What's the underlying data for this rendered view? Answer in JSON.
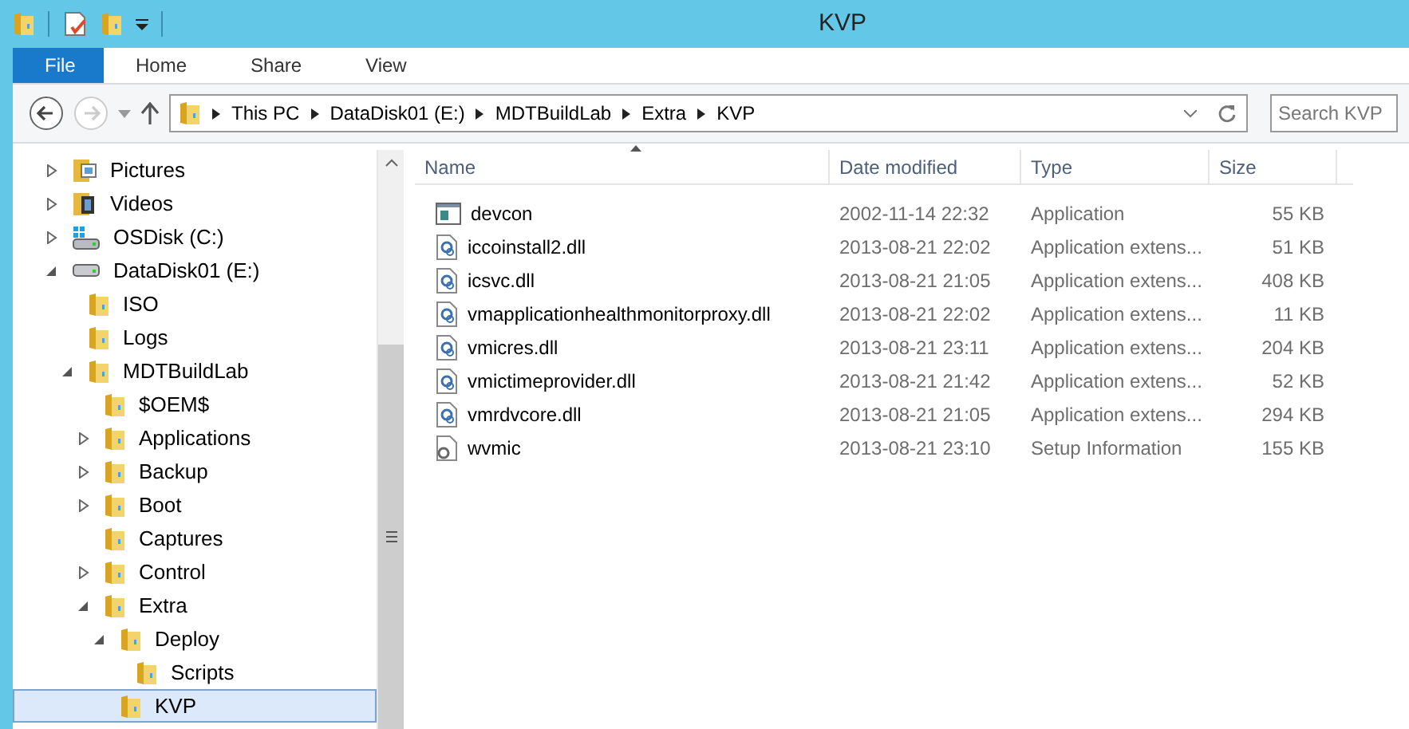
{
  "window": {
    "title": "KVP"
  },
  "ribbon_tabs": [
    {
      "label": "File",
      "selected": true
    },
    {
      "label": "Home",
      "selected": false
    },
    {
      "label": "Share",
      "selected": false
    },
    {
      "label": "View",
      "selected": false
    }
  ],
  "navigation": {
    "back_disabled": false,
    "forward_disabled": true
  },
  "address_bar": {
    "breadcrumbs": [
      "This PC",
      "DataDisk01 (E:)",
      "MDTBuildLab",
      "Extra",
      "KVP"
    ]
  },
  "search": {
    "placeholder": "Search KVP"
  },
  "tree": [
    {
      "label": "Pictures",
      "kind": "pictures",
      "expanded": false,
      "selected": false
    },
    {
      "label": "Videos",
      "kind": "videos",
      "expanded": false,
      "selected": false
    },
    {
      "label": "OSDisk (C:)",
      "kind": "os-drive",
      "expanded": false,
      "selected": false
    },
    {
      "label": "DataDisk01 (E:)",
      "kind": "drive",
      "expanded": true,
      "selected": false,
      "children": [
        {
          "label": "ISO",
          "kind": "folder",
          "selected": false
        },
        {
          "label": "Logs",
          "kind": "folder",
          "selected": false
        },
        {
          "label": "MDTBuildLab",
          "kind": "folder",
          "expanded": true,
          "selected": false,
          "children": [
            {
              "label": "$OEM$",
              "kind": "folder",
              "selected": false
            },
            {
              "label": "Applications",
              "kind": "folder",
              "expanded": false,
              "selected": false
            },
            {
              "label": "Backup",
              "kind": "folder",
              "expanded": false,
              "selected": false
            },
            {
              "label": "Boot",
              "kind": "folder",
              "expanded": false,
              "selected": false
            },
            {
              "label": "Captures",
              "kind": "folder",
              "selected": false
            },
            {
              "label": "Control",
              "kind": "folder",
              "expanded": false,
              "selected": false
            },
            {
              "label": "Extra",
              "kind": "folder",
              "expanded": true,
              "selected": false,
              "children": [
                {
                  "label": "Deploy",
                  "kind": "folder",
                  "expanded": true,
                  "selected": false,
                  "children": [
                    {
                      "label": "Scripts",
                      "kind": "folder",
                      "selected": false
                    }
                  ]
                },
                {
                  "label": "KVP",
                  "kind": "folder",
                  "selected": true
                }
              ]
            }
          ]
        }
      ]
    }
  ],
  "table": {
    "columns": [
      "Name",
      "Date modified",
      "Type",
      "Size"
    ],
    "rows": [
      {
        "kind": "app",
        "name": "devcon",
        "date": "2002-11-14 22:32",
        "type": "Application",
        "size": "55 KB"
      },
      {
        "kind": "dll",
        "name": "iccoinstall2.dll",
        "date": "2013-08-21 22:02",
        "type": "Application extens...",
        "size": "51 KB"
      },
      {
        "kind": "dll",
        "name": "icsvc.dll",
        "date": "2013-08-21 21:05",
        "type": "Application extens...",
        "size": "408 KB"
      },
      {
        "kind": "dll",
        "name": "vmapplicationhealthmonitorproxy.dll",
        "date": "2013-08-21 22:02",
        "type": "Application extens...",
        "size": "11 KB"
      },
      {
        "kind": "dll",
        "name": "vmicres.dll",
        "date": "2013-08-21 23:11",
        "type": "Application extens...",
        "size": "204 KB"
      },
      {
        "kind": "dll",
        "name": "vmictimeprovider.dll",
        "date": "2013-08-21 21:42",
        "type": "Application extens...",
        "size": "52 KB"
      },
      {
        "kind": "dll",
        "name": "vmrdvcore.dll",
        "date": "2013-08-21 21:05",
        "type": "Application extens...",
        "size": "294 KB"
      },
      {
        "kind": "inf",
        "name": "wvmic",
        "date": "2013-08-21 23:10",
        "type": "Setup Information",
        "size": "155 KB"
      }
    ]
  }
}
